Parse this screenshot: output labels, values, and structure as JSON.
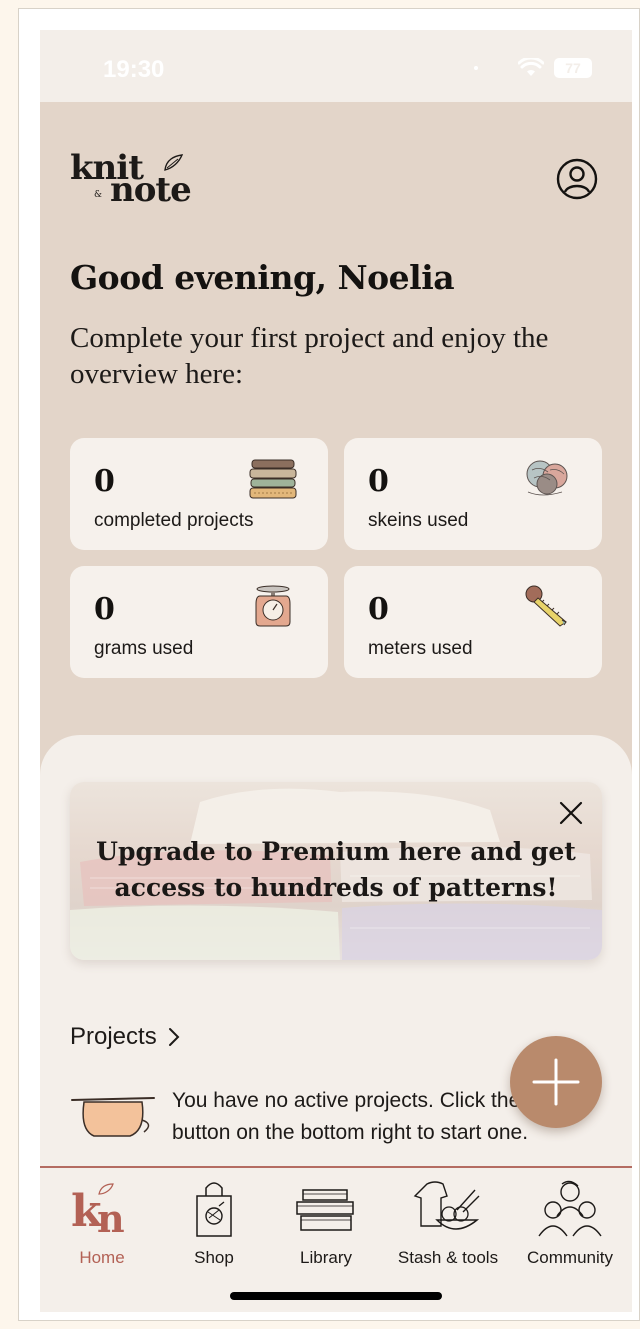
{
  "status_bar": {
    "time": "19:30",
    "battery": "77"
  },
  "header": {
    "logo_line1": "knit",
    "logo_amp": "&",
    "logo_line2": "note",
    "profile_icon": "user-circle-icon"
  },
  "greeting": "Good evening, Noelia",
  "subtitle": "Complete your first project and enjoy the overview here:",
  "stats": [
    {
      "value": "0",
      "label": "completed projects",
      "icon": "folded-sweaters-icon"
    },
    {
      "value": "0",
      "label": "skeins used",
      "icon": "yarn-balls-icon"
    },
    {
      "value": "0",
      "label": "grams used",
      "icon": "kitchen-scale-icon"
    },
    {
      "value": "0",
      "label": "meters used",
      "icon": "measuring-tape-icon"
    }
  ],
  "promo": {
    "text": "Upgrade to Premium here and get access to hundreds of patterns!",
    "close_icon": "close-icon"
  },
  "projects": {
    "title": "Projects",
    "empty_text": "You have no active projects. Click the button on the bottom right to start one."
  },
  "fab": {
    "icon": "plus-icon"
  },
  "tabbar": {
    "items": [
      {
        "label": "Home",
        "icon": "kn-logo-icon",
        "active": true
      },
      {
        "label": "Shop",
        "icon": "shopping-bag-icon",
        "active": false
      },
      {
        "label": "Library",
        "icon": "books-icon",
        "active": false
      },
      {
        "label": "Stash & tools",
        "icon": "stash-tools-icon",
        "active": false
      },
      {
        "label": "Community",
        "icon": "people-icon",
        "active": false
      }
    ]
  },
  "colors": {
    "accent": "#b36155",
    "background": "#e3d5c9",
    "card": "#f6f1ec",
    "fab": "#b98a6c"
  }
}
